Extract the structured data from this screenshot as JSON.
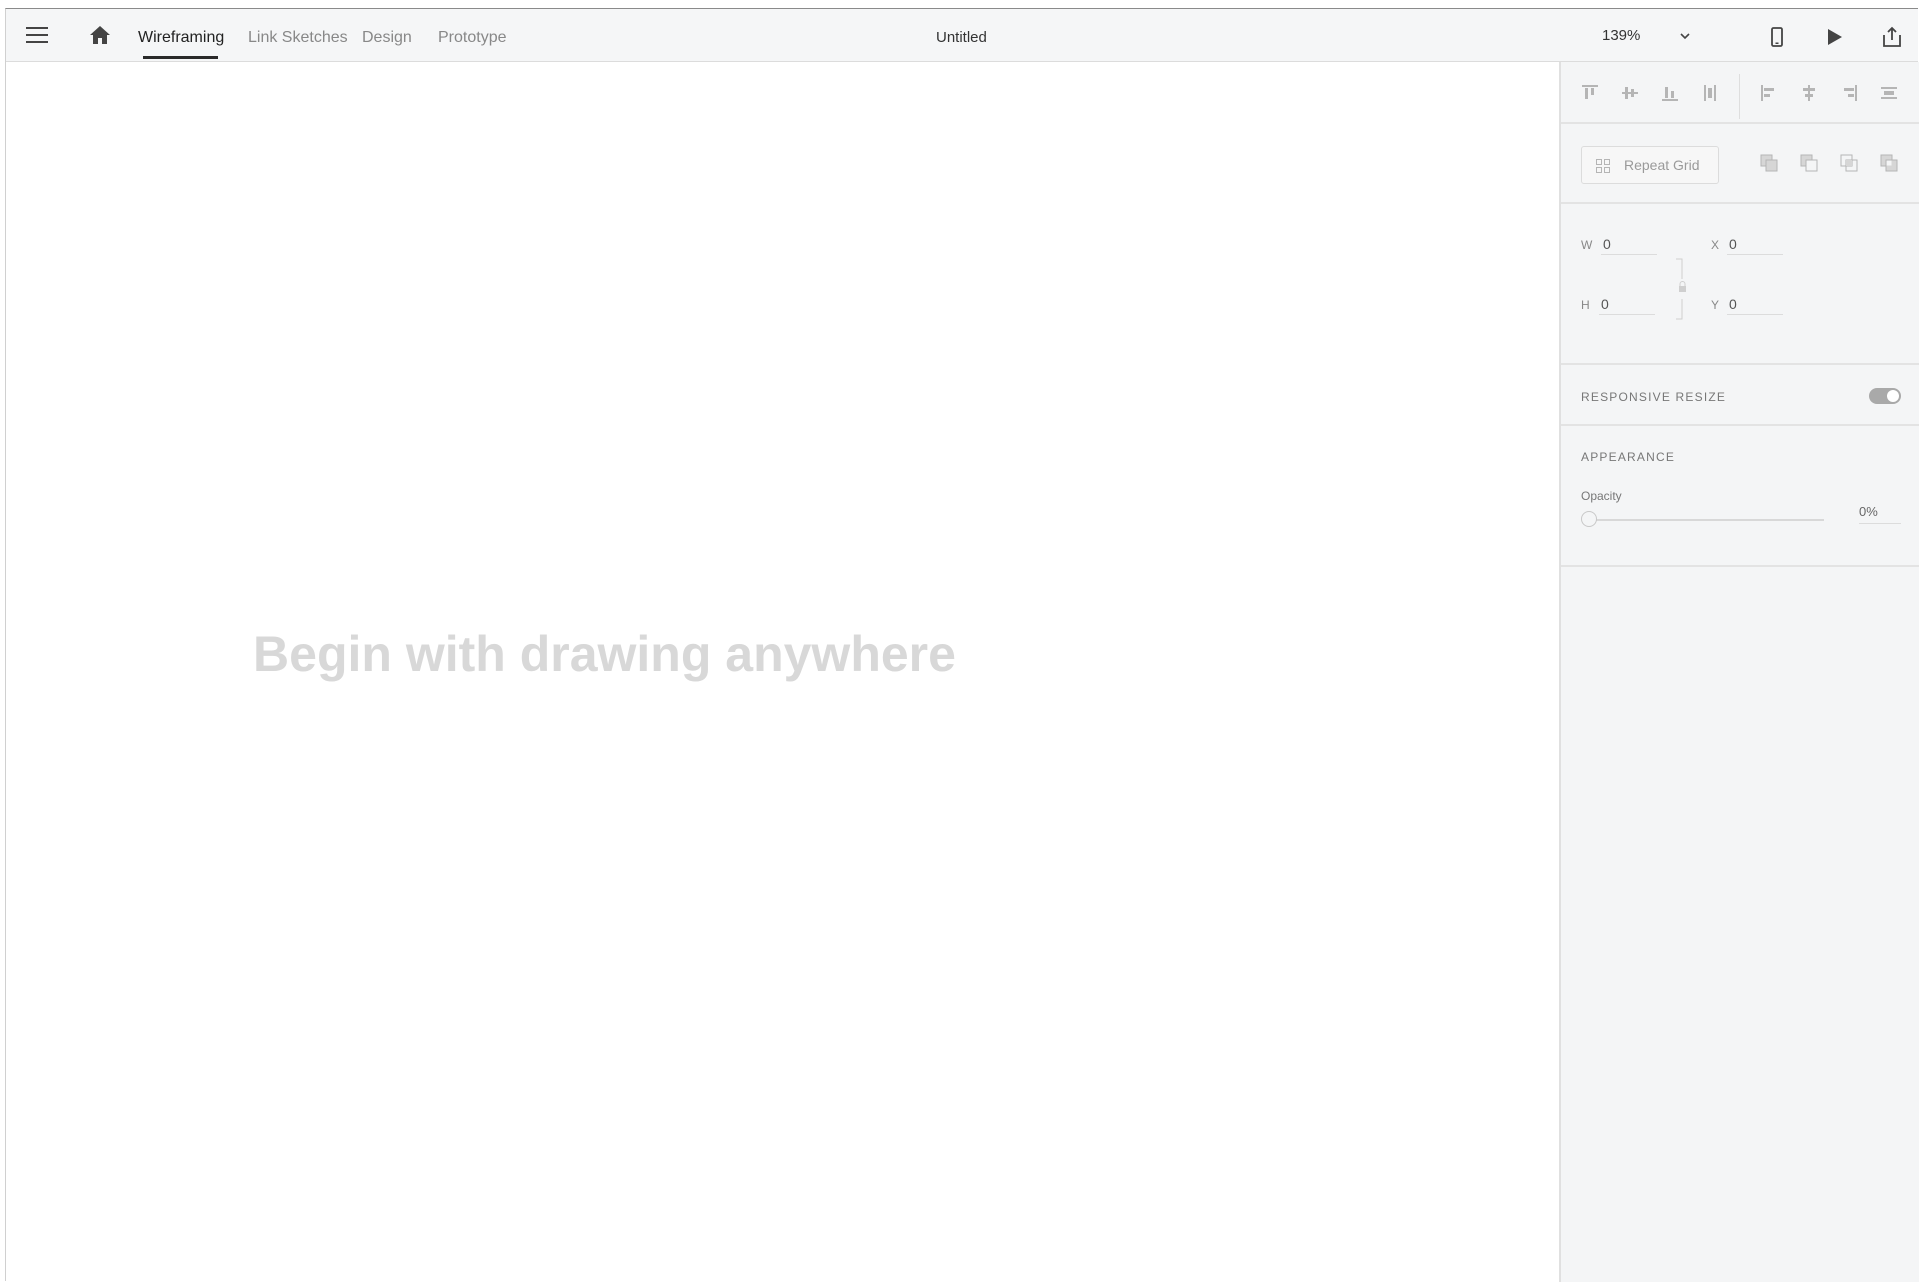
{
  "header": {
    "tabs": [
      {
        "label": "Wireframing",
        "active": true
      },
      {
        "label": "Link Sketches",
        "active": false
      },
      {
        "label": "Design",
        "active": false
      },
      {
        "label": "Prototype",
        "active": false
      }
    ],
    "document_title": "Untitled",
    "zoom": "139%",
    "icons": [
      "menu-icon",
      "home-icon",
      "chevron-down-icon",
      "device-preview-icon",
      "play-icon",
      "share-icon"
    ]
  },
  "canvas": {
    "hint": "Begin with drawing anywhere"
  },
  "panel": {
    "align_icons": [
      "align-top-icon",
      "align-middle-icon",
      "align-bottom-icon",
      "distribute-vertical-icon",
      "align-left-icon",
      "align-center-icon",
      "align-right-icon",
      "distribute-horizontal-icon"
    ],
    "repeat_grid": {
      "label": "Repeat Grid"
    },
    "boolean_icons": [
      "add-icon",
      "subtract-icon",
      "intersect-icon",
      "exclude-icon"
    ],
    "dimensions": {
      "w_label": "W",
      "w_value": "0",
      "h_label": "H",
      "h_value": "0",
      "x_label": "X",
      "x_value": "0",
      "y_label": "Y",
      "y_value": "0"
    },
    "responsive_resize": {
      "title": "RESPONSIVE RESIZE",
      "enabled": true
    },
    "appearance": {
      "title": "APPEARANCE",
      "opacity_label": "Opacity",
      "opacity_value": "0%",
      "opacity_fraction": 0
    }
  },
  "colors": {
    "header_bg": "#f5f6f7",
    "panel_bg": "#f4f5f6",
    "hint_text": "#d8d8d8",
    "active_tab_underline": "#2a2a2a"
  }
}
